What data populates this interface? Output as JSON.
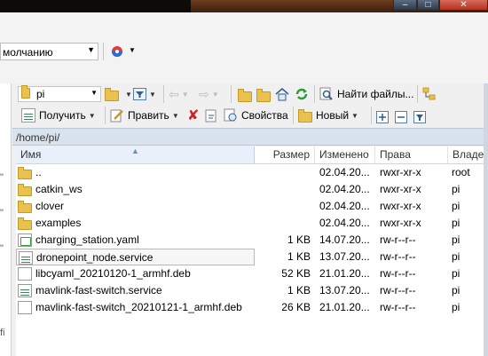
{
  "session": {
    "default_label": "молчанию"
  },
  "toolbar": {
    "path_value": "pi",
    "find_files_label": "Найти файлы...",
    "get_label": "Получить",
    "edit_label": "Править",
    "properties_label": "Свойства",
    "new_label": "Новый"
  },
  "path_bar": {
    "path": "/home/pi/"
  },
  "columns": {
    "name": "Имя",
    "size": "Размер",
    "modified": "Изменено",
    "rights": "Права",
    "owner": "Владе"
  },
  "files": [
    {
      "name": "..",
      "size": "",
      "modified": "02.04.20...",
      "rights": "rwxr-xr-x",
      "owner": "root",
      "icon": "parent-folder-icon"
    },
    {
      "name": "catkin_ws",
      "size": "",
      "modified": "02.04.20...",
      "rights": "rwxr-xr-x",
      "owner": "pi",
      "icon": "folder-icon"
    },
    {
      "name": "clover",
      "size": "",
      "modified": "02.04.20...",
      "rights": "rwxr-xr-x",
      "owner": "pi",
      "icon": "folder-icon"
    },
    {
      "name": "examples",
      "size": "",
      "modified": "02.04.20...",
      "rights": "rwxr-xr-x",
      "owner": "pi",
      "icon": "folder-icon"
    },
    {
      "name": "charging_station.yaml",
      "size": "1 KB",
      "modified": "14.07.20...",
      "rights": "rw-r--r--",
      "owner": "pi",
      "icon": "yaml-file-icon"
    },
    {
      "name": "dronepoint_node.service",
      "size": "1 KB",
      "modified": "13.07.20...",
      "rights": "rw-r--r--",
      "owner": "pi",
      "icon": "service-file-icon"
    },
    {
      "name": "libcyaml_20210120-1_armhf.deb",
      "size": "52 KB",
      "modified": "21.01.20...",
      "rights": "rw-r--r--",
      "owner": "pi",
      "icon": "file-icon"
    },
    {
      "name": "mavlink-fast-switch.service",
      "size": "1 KB",
      "modified": "13.07.20...",
      "rights": "rw-r--r--",
      "owner": "pi",
      "icon": "service-file-icon"
    },
    {
      "name": "mavlink-fast-switch_20210121-1_armhf.deb",
      "size": "26 KB",
      "modified": "21.01.20...",
      "rights": "rw-r--r--",
      "owner": "pi",
      "icon": "file-icon"
    }
  ]
}
